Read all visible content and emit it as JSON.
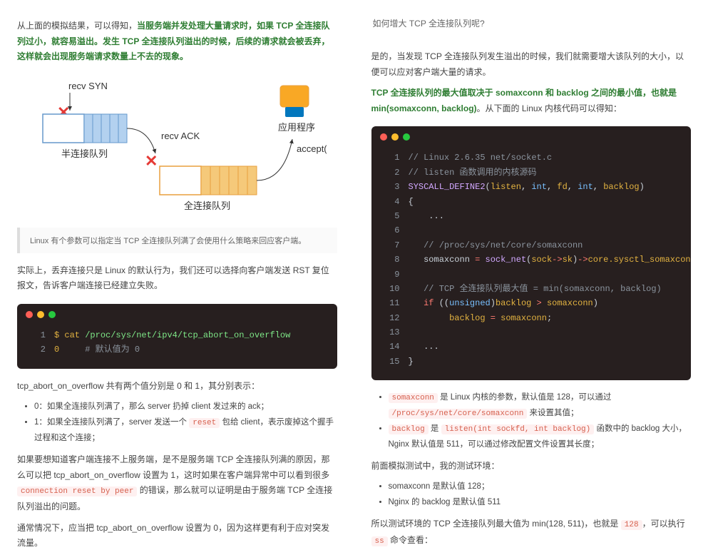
{
  "left": {
    "p1_a": "从上面的模拟结果，可以得知，",
    "p1_b": "当服务端并发处理大量请求时，如果 TCP 全连接队列过小，就容易溢出。发生 TCP 全连接队列溢出的时候，后续的请求就会被丢弃，这样就会出现服务端请求数量上不去的现象。",
    "diagram": {
      "recv_syn": "recv SYN",
      "recv_ack": "recv ACK",
      "semi_queue": "半连接队列",
      "full_queue": "全连接队列",
      "app": "应用程序",
      "accept": "accept()"
    },
    "quote1": "Linux 有个参数可以指定当 TCP 全连接队列满了会使用什么策略来回应客户端。",
    "p2": "实际上，丢弃连接只是 Linux 的默认行为，我们还可以选择向客户端发送 RST 复位报文，告诉客户端连接已经建立失败。",
    "code1": {
      "l1_prompt": "$",
      "l1_cmd": "cat",
      "l1_path": "/proc/sys/net/ipv4/tcp_abort_on_overflow",
      "l2_val": "0",
      "l2_cm": "# 默认值为 0"
    },
    "p3": "tcp_abort_on_overflow 共有两个值分别是 0 和 1，其分别表示：",
    "li1": "0：如果全连接队列满了，那么 server 扔掉 client 发过来的 ack；",
    "li2": "1：如果全连接队列满了，server 发送一个",
    "li2_code": "reset",
    "li2_b": "包给 client，表示废掉这个握手过程和这个连接；",
    "p4a": "如果要想知道客户端连接不上服务端，是不是服务端 TCP 全连接队列满的原因，那么可以把 tcp_abort_on_overflow 设置为 1，这时如果在客户端异常中可以看到很多",
    "p4_code": "connection reset by peer",
    "p4b": "的错误，那么就可以证明是由于服务端 TCP 全连接队列溢出的问题。",
    "p5": "通常情况下，应当把 tcp_abort_on_overflow 设置为 0，因为这样更有利于应对突发流量。"
  },
  "right": {
    "h1": "如何增大 TCP 全连接队列呢?",
    "p1": "是的，当发现 TCP 全连接队列发生溢出的时候，我们就需要增大该队列的大小，以便可以应对客户端大量的请求。",
    "p2_bold": "TCP 全连接队列的最大值取决于 somaxconn 和 backlog 之间的最小值，也就是 min(somaxconn, backlog)",
    "p2_tail": "。从下面的 Linux 内核代码可以得知：",
    "code2": {
      "l1": "// Linux 2.6.35 net/socket.c",
      "l2": "// listen 函数调用的内核源码",
      "l3_a": "SYSCALL_DEFINE2",
      "l3_b": "listen",
      "l3_c": "int",
      "l3_d": "fd",
      "l3_e": "int",
      "l3_f": "backlog",
      "l4": "{",
      "l5": "    ...",
      "l7": "   // /proc/sys/net/core/somaxconn",
      "l8_a": "   somaxconn ",
      "l8_b": " sock_net",
      "l8_c": "sock",
      "l8_d": "sk",
      "l8_e": "core.sysctl_somaxconn",
      "l10": "   // TCP 全连接队列最大值 = min(somaxconn, backlog)",
      "l11_a": "   if",
      "l11_b": "unsigned",
      "l11_c": "backlog ",
      "l11_d": " somaxconn",
      "l12_a": "        backlog ",
      "l12_b": " somaxconn",
      "l14": "   ...",
      "l15": "}"
    },
    "li_a_code": "somaxconn",
    "li_a": " 是 Linux 内核的参数，默认值是 128，可以通过 ",
    "li_a_code2": "/proc/sys/net/core/somaxconn",
    "li_a_tail": " 来设置其值；",
    "li_b_code": "backlog",
    "li_b_mid": " 是 ",
    "li_b_code2": "listen(int sockfd, int backlog)",
    "li_b_tail": " 函数中的 backlog 大小，Nginx 默认值是 511，可以通过修改配置文件设置其长度；",
    "p3": "前面模拟测试中，我的测试环境：",
    "li_c": "somaxconn 是默认值 128；",
    "li_d": "Nginx 的 backlog 是默认值 511",
    "p4_a": "所以测试环境的 TCP 全连接队列最大值为 min(128, 511)，也就是 ",
    "p4_code": "128",
    "p4_b": "，可以执行 ",
    "p4_code2": "ss",
    "p4_c": " 命令查看："
  }
}
